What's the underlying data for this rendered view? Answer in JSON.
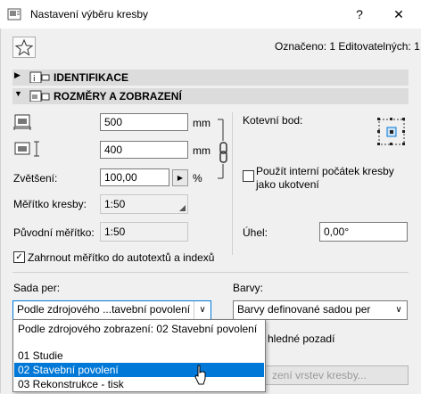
{
  "window": {
    "title": "Nastavení výběru kresby",
    "help": "?",
    "close": "✕"
  },
  "header": {
    "status": "Označeno: 1 Editovatelných: 1"
  },
  "sections": {
    "identification": "IDENTIFIKACE",
    "dimensions": "ROZMĚRY A ZOBRAZENÍ"
  },
  "size": {
    "width_value": "500",
    "width_unit": "mm",
    "height_value": "400",
    "height_unit": "mm",
    "zoom_label": "Zvětšení:",
    "zoom_value": "100,00",
    "zoom_unit": "%",
    "scale_label": "Měřítko kresby:",
    "scale_value": "1:50",
    "original_scale_label": "Původní měřítko:",
    "original_scale_value": "1:50"
  },
  "anchor": {
    "label": "Kotevní bod:",
    "internal_origin_label_line1": "Použít interní počátek kresby",
    "internal_origin_label_line2": "jako ukotvení",
    "angle_label": "Úhel:",
    "angle_value": "0,00°"
  },
  "include_scale": {
    "label": "Zahrnout měřítko do autotextů a indexů",
    "checked": "✓"
  },
  "set_by": {
    "label": "Sada per:",
    "value": "Podle zdrojového ...tavební povolení",
    "options": [
      "Podle zdrojového zobrazení: 02 Stavební povolení",
      "",
      "01 Studie",
      "02 Stavební povolení",
      "03 Rekonstrukce - tisk"
    ],
    "selected_index": 3
  },
  "colors": {
    "label": "Barvy:",
    "value": "Barvy definované sadou per",
    "background_label_partial": "hledné pozadí",
    "layer_button_partial": "zení vrstev kresby..."
  },
  "accent": "#0078d7"
}
